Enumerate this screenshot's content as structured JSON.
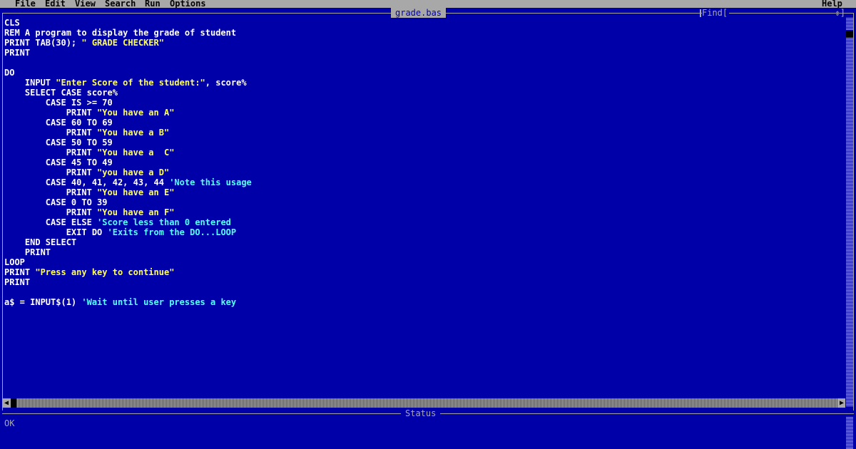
{
  "menu": {
    "items": [
      "File",
      "Edit",
      "View",
      "Search",
      "Run",
      "Options"
    ],
    "help": "Help"
  },
  "editor": {
    "file_title": "grade.bas",
    "find_label": "Find[",
    "find_arrow": "⇕]",
    "lines": [
      [
        {
          "t": "CLS",
          "c": "kw"
        }
      ],
      [
        {
          "t": "REM A program to display the grade of student",
          "c": "kw"
        }
      ],
      [
        {
          "t": "PRINT TAB(30); ",
          "c": "kw"
        },
        {
          "t": "\" GRADE CHECKER\"",
          "c": "str"
        }
      ],
      [
        {
          "t": "PRINT",
          "c": "kw"
        }
      ],
      [],
      [
        {
          "t": "DO",
          "c": "kw"
        }
      ],
      [
        {
          "t": "    INPUT ",
          "c": "kw"
        },
        {
          "t": "\"Enter Score of the student:\"",
          "c": "str"
        },
        {
          "t": ", score%",
          "c": "kw"
        }
      ],
      [
        {
          "t": "    SELECT CASE score%",
          "c": "kw"
        }
      ],
      [
        {
          "t": "        CASE IS >= 70",
          "c": "kw"
        }
      ],
      [
        {
          "t": "            PRINT ",
          "c": "kw"
        },
        {
          "t": "\"You have an A\"",
          "c": "str"
        }
      ],
      [
        {
          "t": "        CASE 60 TO 69",
          "c": "kw"
        }
      ],
      [
        {
          "t": "            PRINT ",
          "c": "kw"
        },
        {
          "t": "\"You have a B\"",
          "c": "str"
        }
      ],
      [
        {
          "t": "        CASE 50 TO 59",
          "c": "kw"
        }
      ],
      [
        {
          "t": "            PRINT ",
          "c": "kw"
        },
        {
          "t": "\"You have a  C\"",
          "c": "str"
        }
      ],
      [
        {
          "t": "        CASE 45 TO 49",
          "c": "kw"
        }
      ],
      [
        {
          "t": "            PRINT ",
          "c": "kw"
        },
        {
          "t": "\"you have a D\"",
          "c": "str"
        }
      ],
      [
        {
          "t": "        CASE 40, 41, 42, 43, 44 ",
          "c": "kw"
        },
        {
          "t": "'Note this usage",
          "c": "cmt"
        }
      ],
      [
        {
          "t": "            PRINT ",
          "c": "kw"
        },
        {
          "t": "\"You have an E\"",
          "c": "str"
        }
      ],
      [
        {
          "t": "        CASE 0 TO 39",
          "c": "kw"
        }
      ],
      [
        {
          "t": "            PRINT ",
          "c": "kw"
        },
        {
          "t": "\"You have an F\"",
          "c": "str"
        }
      ],
      [
        {
          "t": "        CASE ELSE ",
          "c": "kw"
        },
        {
          "t": "'Score less than 0 entered",
          "c": "cmt"
        }
      ],
      [
        {
          "t": "            EXIT DO ",
          "c": "kw"
        },
        {
          "t": "'Exits from the DO...LOOP",
          "c": "cmt"
        }
      ],
      [
        {
          "t": "    END SELECT",
          "c": "kw"
        }
      ],
      [
        {
          "t": "    PRINT",
          "c": "kw"
        }
      ],
      [
        {
          "t": "LOOP",
          "c": "kw"
        }
      ],
      [
        {
          "t": "PRINT ",
          "c": "kw"
        },
        {
          "t": "\"Press any key to continue\"",
          "c": "str"
        }
      ],
      [
        {
          "t": "PRINT",
          "c": "kw"
        }
      ],
      [],
      [
        {
          "t": "a$ = INPUT$(1) ",
          "c": "kw"
        },
        {
          "t": "'Wait until user presses a key",
          "c": "cmt"
        }
      ]
    ]
  },
  "status": {
    "title": "Status",
    "text": "OK"
  },
  "colors": {
    "background": "#0000a8",
    "text": "#ffffff",
    "string": "#ffff55",
    "comment": "#55ffff",
    "chrome": "#a8a8a8"
  }
}
